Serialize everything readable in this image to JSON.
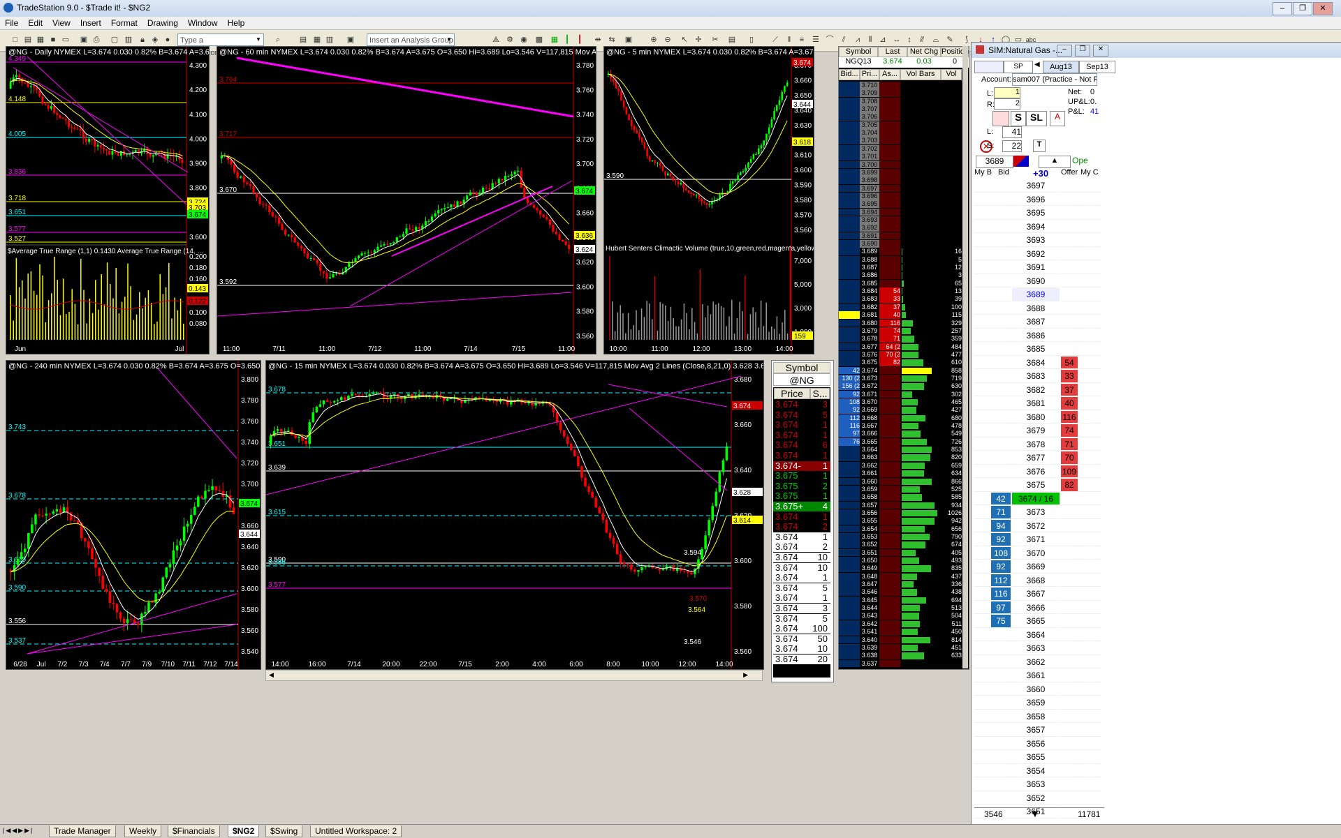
{
  "app": {
    "title": "TradeStation 9.0 - $Trade it! - $NG2"
  },
  "menu": [
    "File",
    "Edit",
    "View",
    "Insert",
    "Format",
    "Drawing",
    "Window",
    "Help"
  ],
  "toolbar": {
    "symbol_placeholder": "Type a symbol/command",
    "analysis_placeholder": "Insert an Analysis Group"
  },
  "charts": {
    "daily": {
      "title": "@NG - Daily  NYMEX  L=3.674  0.030   0.82%   B=3.674  A=3.6",
      "levels": [
        "4.349",
        "4.148",
        "4.005",
        "3.836",
        "3.718",
        "3.651",
        "3.577",
        "3.527"
      ],
      "price_axis": [
        "4.300",
        "4.200",
        "4.100",
        "4.000",
        "3.900",
        "3.800",
        "3.700",
        "3.600"
      ],
      "axis_tags": [
        "3.724",
        "3.703",
        "3.674"
      ],
      "indicator": "$Average True Range (1,1)   0.1430   Average True Range (14, ...",
      "ind_axis": [
        "0.200",
        "0.180",
        "0.160",
        "0.140",
        "0.120",
        "0.100",
        "0.080"
      ],
      "ind_tags": [
        "0.143",
        "0.122"
      ],
      "x_labels": [
        "Jun",
        "Jul"
      ]
    },
    "min60": {
      "title": "@NG - 60 min  NYMEX  L=3.674  0.030   0.82%   B=3.674  A=3.675  O=3.650  Hi=3.689  Lo=3.546  V=117,815  Mov Avg 2 Line",
      "levels": [
        "3.764",
        "3.717",
        "3.670",
        "3.592"
      ],
      "price_axis": [
        "3.780",
        "3.760",
        "3.740",
        "3.720",
        "3.700",
        "3.680",
        "3.660",
        "3.640",
        "3.620",
        "3.600",
        "3.580",
        "3.560"
      ],
      "axis_tags": [
        "3.674",
        "3.636",
        "3.624"
      ],
      "x_labels": [
        "11:00",
        "7/11",
        "11:00",
        "7/12",
        "11:00",
        "7/14",
        "7/15",
        "11:00"
      ]
    },
    "min5": {
      "title": "@NG - 5 min  NYMEX  L=3.674  0.030   0.82%   B=3.674  A=3.675  O=3",
      "level": "3.590",
      "price_axis": [
        "3.670",
        "3.660",
        "3.650",
        "3.640",
        "3.630",
        "3.620",
        "3.610",
        "3.600",
        "3.590",
        "3.580",
        "3.570",
        "3.560"
      ],
      "axis_tags": [
        "3.674",
        "3.644",
        "3.618"
      ],
      "indicator": "Hubert Senters Climactic Volume (true,10,green,red,magenta,yellow,dar ...",
      "ind_axis": [
        "7,000",
        "5,000",
        "3,000",
        "1,000"
      ],
      "ind_tag": "159",
      "x_labels": [
        "10:00",
        "11:00",
        "12:00",
        "13:00",
        "14:00"
      ]
    },
    "min240": {
      "title": "@NG - 240 min  NYMEX  L=3.674  0.030   0.82%   B=3.674  A=3.675  O=3.650  H",
      "levels": [
        "3.743",
        "3.678",
        "3.615",
        "3.590",
        "3.556",
        "3.537"
      ],
      "price_axis": [
        "3.800",
        "3.780",
        "3.760",
        "3.740",
        "3.720",
        "3.700",
        "3.680",
        "3.660",
        "3.640",
        "3.620",
        "3.600",
        "3.580",
        "3.560",
        "3.540"
      ],
      "axis_tags": [
        "3.674",
        "3.644"
      ],
      "x_labels": [
        "6/28",
        "Jul",
        "7/2",
        "7/3",
        "7/4",
        "7/7",
        "7/9",
        "7/10",
        "7/11",
        "7/12",
        "7/14"
      ]
    },
    "min15": {
      "title": "@NG - 15 min  NYMEX  L=3.674  0.030   0.82%   B=3.674  A=3.675  O=3.650  Hi=3.689  Lo=3.546  V=117,815  Mov Avg 2 Lines (Close,8,21,0)   3.628   3.614",
      "levels": [
        "3.678",
        "3.651",
        "3.639",
        "3.615",
        "3.590",
        "3.586",
        "3.577"
      ],
      "price_axis": [
        "3.680",
        "3.660",
        "3.640",
        "3.620",
        "3.600",
        "3.580",
        "3.560"
      ],
      "axis_tags": [
        "3.674",
        "3.628",
        "3.614"
      ],
      "annot": [
        "3.594",
        "3.570",
        "3.564",
        "3.546"
      ],
      "x_labels": [
        "14:00",
        "16:00",
        "7/14",
        "20:00",
        "22:00",
        "7/15",
        "2:00",
        "4:00",
        "6:00",
        "8:00",
        "10:00",
        "12:00",
        "14:00"
      ]
    }
  },
  "tns": {
    "symbol_header": "Symbol",
    "symbol": "@NG",
    "col_price": "Price",
    "col_size": "S...",
    "rows": [
      [
        "3.674",
        "3",
        "r"
      ],
      [
        "3.674",
        "5",
        "r"
      ],
      [
        "3.674",
        "1",
        "r"
      ],
      [
        "3.674",
        "1",
        "r"
      ],
      [
        "3.674",
        "6",
        "r"
      ],
      [
        "3.674",
        "1",
        "r"
      ],
      [
        "3.674-",
        "1",
        "rb"
      ],
      [
        "3.675",
        "1",
        "g"
      ],
      [
        "3.675",
        "2",
        "g"
      ],
      [
        "3.675",
        "1",
        "g"
      ],
      [
        "3.675+",
        "4",
        "gb"
      ],
      [
        "3.674",
        "1",
        "r"
      ],
      [
        "3.674",
        "2",
        "r"
      ],
      [
        "3.674",
        "1",
        "w"
      ],
      [
        "3.674",
        "2",
        "w"
      ],
      [
        "3.674",
        "10",
        "w"
      ],
      [
        "3.674",
        "10",
        "w"
      ],
      [
        "3.674",
        "1",
        "w"
      ],
      [
        "3.674",
        "5",
        "w"
      ],
      [
        "3.674",
        "1",
        "w"
      ],
      [
        "3.674",
        "3",
        "w"
      ],
      [
        "3.674",
        "5",
        "w"
      ],
      [
        "3.674",
        "100",
        "w"
      ],
      [
        "3.674",
        "50",
        "w"
      ],
      [
        "3.674",
        "10",
        "w"
      ],
      [
        "3.674",
        "20",
        "w"
      ]
    ]
  },
  "radar": {
    "headers": [
      "Symbol",
      "Last",
      "Net Chg",
      "Position"
    ],
    "row": [
      "NGQ13",
      "3.674",
      "0.03",
      "0"
    ],
    "ladder_headers": [
      "Bid...",
      "Pri...",
      "As...",
      "Vol Bars",
      "Vol"
    ],
    "ladder": [
      [
        "",
        "3.710",
        "",
        ""
      ],
      [
        "",
        "3.709",
        "",
        ""
      ],
      [
        "",
        "3.708",
        "",
        ""
      ],
      [
        "",
        "3.707",
        "",
        ""
      ],
      [
        "",
        "3.706",
        "",
        ""
      ],
      [
        "",
        "3.705",
        "",
        ""
      ],
      [
        "",
        "3.704",
        "",
        ""
      ],
      [
        "",
        "3.703",
        "",
        ""
      ],
      [
        "",
        "3.702",
        "",
        ""
      ],
      [
        "",
        "3.701",
        "",
        ""
      ],
      [
        "",
        "3.700",
        "",
        ""
      ],
      [
        "",
        "3.699",
        "",
        ""
      ],
      [
        "",
        "3.698",
        "",
        ""
      ],
      [
        "",
        "3.697",
        "",
        ""
      ],
      [
        "",
        "3.696",
        "",
        ""
      ],
      [
        "",
        "3.695",
        "",
        ""
      ],
      [
        "",
        "3.694",
        "",
        ""
      ],
      [
        "",
        "3.693",
        "",
        ""
      ],
      [
        "",
        "3.692",
        "",
        ""
      ],
      [
        "",
        "3.691",
        "",
        ""
      ],
      [
        "",
        "3.690",
        "",
        ""
      ],
      [
        "",
        "3.689",
        "",
        "16"
      ],
      [
        "",
        "3.688",
        "",
        "5"
      ],
      [
        "",
        "3.687",
        "",
        "12"
      ],
      [
        "",
        "3.686",
        "",
        "3"
      ],
      [
        "",
        "3.685",
        "",
        "65"
      ],
      [
        "",
        "3.684",
        "54",
        "13"
      ],
      [
        "",
        "3.683",
        "33",
        "39"
      ],
      [
        "",
        "3.682",
        "37",
        "100"
      ],
      [
        "",
        "3.681",
        "40",
        "115"
      ],
      [
        "",
        "3.680",
        "116",
        "329"
      ],
      [
        "",
        "3.679",
        "74",
        "257"
      ],
      [
        "",
        "3.678",
        "71",
        "359"
      ],
      [
        "",
        "3.677",
        "64 (2",
        "484"
      ],
      [
        "",
        "3.676",
        "70 (2",
        "477"
      ],
      [
        "",
        "3.675",
        "82",
        "610"
      ],
      [
        "42",
        "3.674",
        "",
        "858"
      ],
      [
        "130 (2",
        "3.673",
        "",
        "719"
      ],
      [
        "156 (2",
        "3.672",
        "",
        "630"
      ],
      [
        "92",
        "3.671",
        "",
        "302"
      ],
      [
        "108",
        "3.670",
        "",
        "465"
      ],
      [
        "92",
        "3.669",
        "",
        "427"
      ],
      [
        "112",
        "3.668",
        "",
        "680"
      ],
      [
        "116",
        "3.667",
        "",
        "478"
      ],
      [
        "97",
        "3.666",
        "",
        "549"
      ],
      [
        "76",
        "3.665",
        "",
        "726"
      ],
      [
        "",
        "3.664",
        "",
        "853"
      ],
      [
        "",
        "3.663",
        "",
        "820"
      ],
      [
        "",
        "3.662",
        "",
        "659"
      ],
      [
        "",
        "3.661",
        "",
        "634"
      ],
      [
        "",
        "3.660",
        "",
        "866"
      ],
      [
        "",
        "3.659",
        "",
        "525"
      ],
      [
        "",
        "3.658",
        "",
        "585"
      ],
      [
        "",
        "3.657",
        "",
        "934"
      ],
      [
        "",
        "3.656",
        "",
        "1026"
      ],
      [
        "",
        "3.655",
        "",
        "942"
      ],
      [
        "",
        "3.654",
        "",
        "656"
      ],
      [
        "",
        "3.653",
        "",
        "790"
      ],
      [
        "",
        "3.652",
        "",
        "674"
      ],
      [
        "",
        "3.651",
        "",
        "405"
      ],
      [
        "",
        "3.650",
        "",
        "493"
      ],
      [
        "",
        "3.649",
        "",
        "835"
      ],
      [
        "",
        "3.648",
        "",
        "437"
      ],
      [
        "",
        "3.647",
        "",
        "336"
      ],
      [
        "",
        "3.646",
        "",
        "438"
      ],
      [
        "",
        "3.645",
        "",
        "694"
      ],
      [
        "",
        "3.644",
        "",
        "513"
      ],
      [
        "",
        "3.643",
        "",
        "504"
      ],
      [
        "",
        "3.642",
        "",
        "511"
      ],
      [
        "",
        "3.641",
        "",
        "450"
      ],
      [
        "",
        "3.640",
        "",
        "814"
      ],
      [
        "",
        "3.639",
        "",
        "451"
      ],
      [
        "",
        "3.638",
        "",
        "633"
      ],
      [
        "",
        "3.637",
        "",
        ""
      ]
    ]
  },
  "matrix": {
    "title": "SIM:Natural Gas -...",
    "symbol": "SP",
    "months": [
      "Aug13",
      "Sep13"
    ],
    "account_label": "Account:",
    "account": "sam007 (Practice - Not Revie",
    "l_label": "L:",
    "r_label": "R:",
    "l_val": "1",
    "r_val": "2",
    "net_label": "Net:",
    "net": "0",
    "upl_label": "UP&L:",
    "upl": "0.",
    "pl_label": "P&L:",
    "pl": "41",
    "l2_label": "L:",
    "l2": "41",
    "s_label": "S:",
    "s2": "22",
    "t_btn": "T",
    "s_btn": "S",
    "sl_btn": "SL",
    "price_box": "3689",
    "change": "+30",
    "status": "Ope",
    "cols": [
      "My B",
      "Bid",
      "",
      "Offer",
      "My C"
    ],
    "ladder": [
      [
        "",
        "3697",
        ""
      ],
      [
        "",
        "3696",
        ""
      ],
      [
        "",
        "3695",
        ""
      ],
      [
        "",
        "3694",
        ""
      ],
      [
        "",
        "3693",
        ""
      ],
      [
        "",
        "3692",
        ""
      ],
      [
        "",
        "3691",
        ""
      ],
      [
        "",
        "3690",
        ""
      ],
      [
        "",
        "3689",
        ""
      ],
      [
        "",
        "3688",
        ""
      ],
      [
        "",
        "3687",
        ""
      ],
      [
        "",
        "3686",
        ""
      ],
      [
        "",
        "3685",
        ""
      ],
      [
        "",
        "3684",
        "54"
      ],
      [
        "",
        "3683",
        "33"
      ],
      [
        "",
        "3682",
        "37"
      ],
      [
        "",
        "3681",
        "40"
      ],
      [
        "",
        "3680",
        "116"
      ],
      [
        "",
        "3679",
        "74"
      ],
      [
        "",
        "3678",
        "71"
      ],
      [
        "",
        "3677",
        "70"
      ],
      [
        "",
        "3676",
        "109"
      ],
      [
        "",
        "3675",
        "82"
      ],
      [
        "42",
        "3674 / 16",
        ""
      ],
      [
        "71",
        "3673",
        ""
      ],
      [
        "94",
        "3672",
        ""
      ],
      [
        "92",
        "3671",
        ""
      ],
      [
        "108",
        "3670",
        ""
      ],
      [
        "92",
        "3669",
        ""
      ],
      [
        "112",
        "3668",
        ""
      ],
      [
        "116",
        "3667",
        ""
      ],
      [
        "97",
        "3666",
        ""
      ],
      [
        "75",
        "3665",
        ""
      ],
      [
        "",
        "3664",
        ""
      ],
      [
        "",
        "3663",
        ""
      ],
      [
        "",
        "3662",
        ""
      ],
      [
        "",
        "3661",
        ""
      ],
      [
        "",
        "3660",
        ""
      ],
      [
        "",
        "3659",
        ""
      ],
      [
        "",
        "3658",
        ""
      ],
      [
        "",
        "3657",
        ""
      ],
      [
        "",
        "3656",
        ""
      ],
      [
        "",
        "3655",
        ""
      ],
      [
        "",
        "3654",
        ""
      ],
      [
        "",
        "3653",
        ""
      ],
      [
        "",
        "3652",
        ""
      ],
      [
        "",
        "3651",
        ""
      ]
    ],
    "footer_left": "3546",
    "footer_right": "11781"
  },
  "tabs": [
    "Trade Manager",
    "Weekly",
    "$Financials",
    "$NG2",
    "$Swing",
    "Untitled Workspace: 2"
  ],
  "colors": {
    "bull": "#00ff00",
    "bear": "#ff0000",
    "ma_fast": "#ffffff",
    "ma_slow": "#ffff00",
    "trend": "#ff00ff"
  }
}
